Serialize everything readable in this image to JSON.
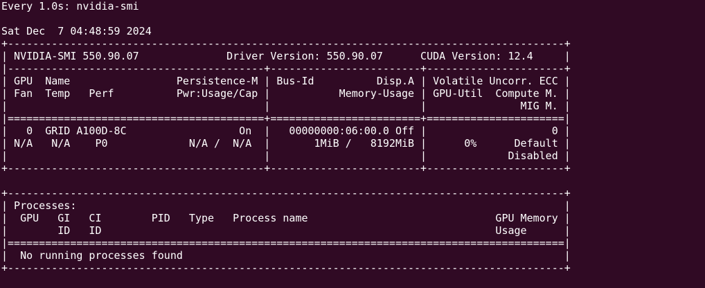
{
  "terminal": {
    "lines": [
      "Every 1.0s: nvidia-smi",
      "",
      "Sat Dec  7 04:48:59 2024",
      "+-----------------------------------------------------------------------------------------+",
      "| NVIDIA-SMI 550.90.07              Driver Version: 550.90.07      CUDA Version: 12.4     |",
      "|-----------------------------------------+------------------------+----------------------+",
      "| GPU  Name                 Persistence-M | Bus-Id          Disp.A | Volatile Uncorr. ECC |",
      "| Fan  Temp   Perf          Pwr:Usage/Cap |           Memory-Usage | GPU-Util  Compute M. |",
      "|                                         |                        |               MIG M. |",
      "|=========================================+========================+======================|",
      "|   0  GRID A100D-8C                  On  |   00000000:06:00.0 Off |                    0 |",
      "| N/A   N/A    P0             N/A /  N/A  |       1MiB /   8192MiB |      0%      Default |",
      "|                                         |                        |             Disabled |",
      "+-----------------------------------------+------------------------+----------------------+",
      "",
      "+-----------------------------------------------------------------------------------------+",
      "| Processes:                                                                              |",
      "|  GPU   GI   CI        PID   Type   Process name                              GPU Memory |",
      "|        ID   ID                                                               Usage      |",
      "|=========================================================================================|",
      "|  No running processes found                                                             |",
      "+-----------------------------------------------------------------------------------------+"
    ]
  }
}
